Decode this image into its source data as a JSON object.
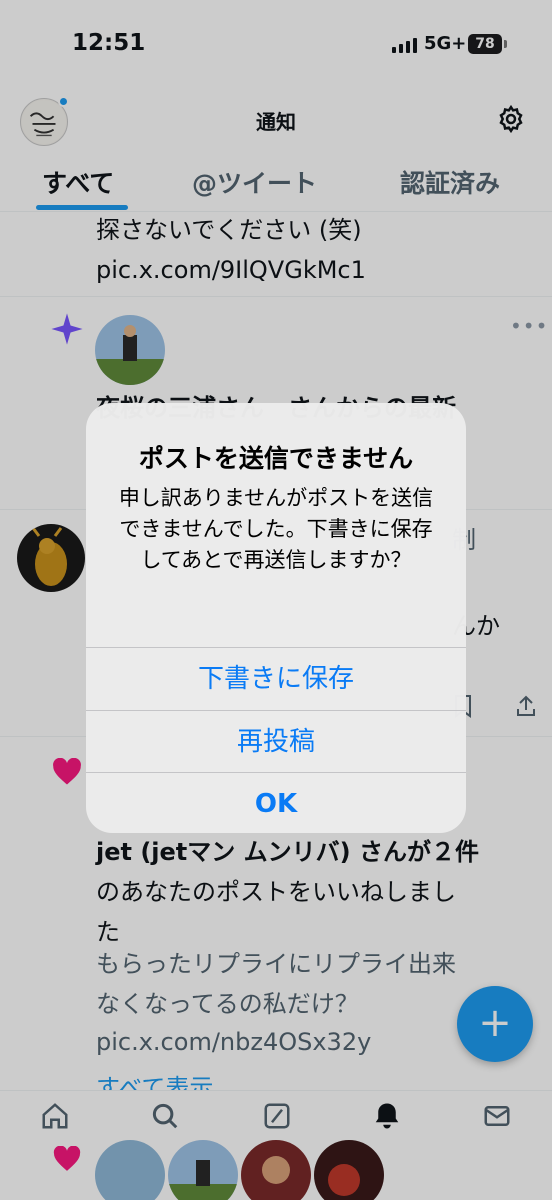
{
  "status_bar": {
    "time": "12:51",
    "network": "5G+",
    "battery": "78"
  },
  "header": {
    "title": "通知"
  },
  "tabs": [
    {
      "label": "すべて"
    },
    {
      "label": "@ツイート"
    },
    {
      "label": "認証済み"
    }
  ],
  "feed": {
    "item1": {
      "line1": "探さないでください (笑)",
      "line2": "pic.x.com/9IlQVGkMc1"
    },
    "item2": {
      "text": "夜桜の三浦さん　さんからの最新"
    },
    "item3": {
      "partial_right": "制",
      "partial_right2": "んか"
    },
    "item4": {
      "line1": "jet (jetマン ムンリバ) さんが２件",
      "line2": "のあなたのポストをいいねしまし",
      "line3": "た",
      "line4": "もらったリプライにリプライ出来",
      "line5": "なくなってるの私だけ？",
      "line6": "pic.x.com/nbz4OSx32y",
      "show_all": "すべて表示"
    }
  },
  "fab": {
    "label": "+"
  },
  "alert": {
    "title": "ポストを送信できません",
    "message": "申し訳ありませんがポストを送信できませんでした。下書きに保存してあとで再送信しますか？",
    "buttons": {
      "save_draft": "下書きに保存",
      "repost": "再投稿",
      "ok": "OK"
    }
  },
  "colors": {
    "accent": "#1d9bf0",
    "alert_button": "#0a7bf5",
    "heart": "#f91880",
    "sparkle": "#7856ff"
  },
  "icons": [
    "gear-icon",
    "sparkle-icon",
    "heart-icon",
    "home-icon",
    "search-icon",
    "grok-icon",
    "bell-icon",
    "mail-icon",
    "share-icon",
    "bookmark-icon",
    "plus-icon"
  ]
}
